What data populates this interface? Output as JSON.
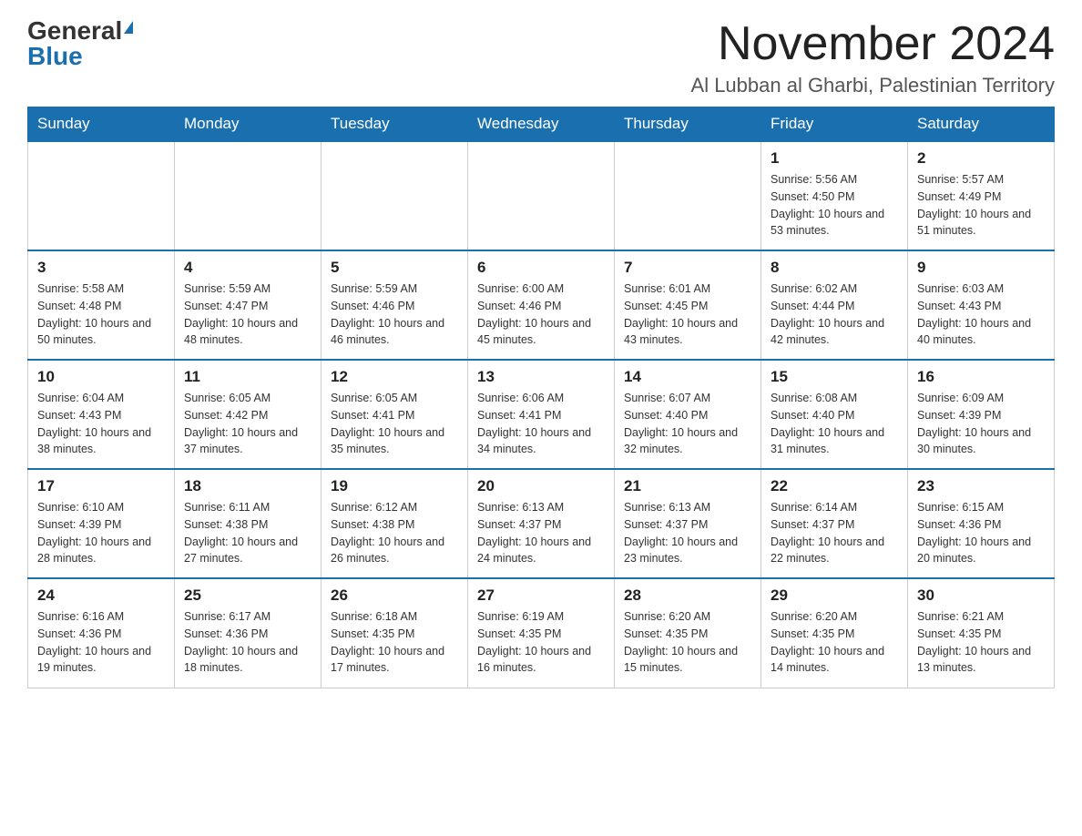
{
  "header": {
    "logo_general": "General",
    "logo_blue": "Blue",
    "month_title": "November 2024",
    "location": "Al Lubban al Gharbi, Palestinian Territory"
  },
  "columns": [
    "Sunday",
    "Monday",
    "Tuesday",
    "Wednesday",
    "Thursday",
    "Friday",
    "Saturday"
  ],
  "weeks": [
    [
      {
        "day": "",
        "sunrise": "",
        "sunset": "",
        "daylight": ""
      },
      {
        "day": "",
        "sunrise": "",
        "sunset": "",
        "daylight": ""
      },
      {
        "day": "",
        "sunrise": "",
        "sunset": "",
        "daylight": ""
      },
      {
        "day": "",
        "sunrise": "",
        "sunset": "",
        "daylight": ""
      },
      {
        "day": "",
        "sunrise": "",
        "sunset": "",
        "daylight": ""
      },
      {
        "day": "1",
        "sunrise": "Sunrise: 5:56 AM",
        "sunset": "Sunset: 4:50 PM",
        "daylight": "Daylight: 10 hours and 53 minutes."
      },
      {
        "day": "2",
        "sunrise": "Sunrise: 5:57 AM",
        "sunset": "Sunset: 4:49 PM",
        "daylight": "Daylight: 10 hours and 51 minutes."
      }
    ],
    [
      {
        "day": "3",
        "sunrise": "Sunrise: 5:58 AM",
        "sunset": "Sunset: 4:48 PM",
        "daylight": "Daylight: 10 hours and 50 minutes."
      },
      {
        "day": "4",
        "sunrise": "Sunrise: 5:59 AM",
        "sunset": "Sunset: 4:47 PM",
        "daylight": "Daylight: 10 hours and 48 minutes."
      },
      {
        "day": "5",
        "sunrise": "Sunrise: 5:59 AM",
        "sunset": "Sunset: 4:46 PM",
        "daylight": "Daylight: 10 hours and 46 minutes."
      },
      {
        "day": "6",
        "sunrise": "Sunrise: 6:00 AM",
        "sunset": "Sunset: 4:46 PM",
        "daylight": "Daylight: 10 hours and 45 minutes."
      },
      {
        "day": "7",
        "sunrise": "Sunrise: 6:01 AM",
        "sunset": "Sunset: 4:45 PM",
        "daylight": "Daylight: 10 hours and 43 minutes."
      },
      {
        "day": "8",
        "sunrise": "Sunrise: 6:02 AM",
        "sunset": "Sunset: 4:44 PM",
        "daylight": "Daylight: 10 hours and 42 minutes."
      },
      {
        "day": "9",
        "sunrise": "Sunrise: 6:03 AM",
        "sunset": "Sunset: 4:43 PM",
        "daylight": "Daylight: 10 hours and 40 minutes."
      }
    ],
    [
      {
        "day": "10",
        "sunrise": "Sunrise: 6:04 AM",
        "sunset": "Sunset: 4:43 PM",
        "daylight": "Daylight: 10 hours and 38 minutes."
      },
      {
        "day": "11",
        "sunrise": "Sunrise: 6:05 AM",
        "sunset": "Sunset: 4:42 PM",
        "daylight": "Daylight: 10 hours and 37 minutes."
      },
      {
        "day": "12",
        "sunrise": "Sunrise: 6:05 AM",
        "sunset": "Sunset: 4:41 PM",
        "daylight": "Daylight: 10 hours and 35 minutes."
      },
      {
        "day": "13",
        "sunrise": "Sunrise: 6:06 AM",
        "sunset": "Sunset: 4:41 PM",
        "daylight": "Daylight: 10 hours and 34 minutes."
      },
      {
        "day": "14",
        "sunrise": "Sunrise: 6:07 AM",
        "sunset": "Sunset: 4:40 PM",
        "daylight": "Daylight: 10 hours and 32 minutes."
      },
      {
        "day": "15",
        "sunrise": "Sunrise: 6:08 AM",
        "sunset": "Sunset: 4:40 PM",
        "daylight": "Daylight: 10 hours and 31 minutes."
      },
      {
        "day": "16",
        "sunrise": "Sunrise: 6:09 AM",
        "sunset": "Sunset: 4:39 PM",
        "daylight": "Daylight: 10 hours and 30 minutes."
      }
    ],
    [
      {
        "day": "17",
        "sunrise": "Sunrise: 6:10 AM",
        "sunset": "Sunset: 4:39 PM",
        "daylight": "Daylight: 10 hours and 28 minutes."
      },
      {
        "day": "18",
        "sunrise": "Sunrise: 6:11 AM",
        "sunset": "Sunset: 4:38 PM",
        "daylight": "Daylight: 10 hours and 27 minutes."
      },
      {
        "day": "19",
        "sunrise": "Sunrise: 6:12 AM",
        "sunset": "Sunset: 4:38 PM",
        "daylight": "Daylight: 10 hours and 26 minutes."
      },
      {
        "day": "20",
        "sunrise": "Sunrise: 6:13 AM",
        "sunset": "Sunset: 4:37 PM",
        "daylight": "Daylight: 10 hours and 24 minutes."
      },
      {
        "day": "21",
        "sunrise": "Sunrise: 6:13 AM",
        "sunset": "Sunset: 4:37 PM",
        "daylight": "Daylight: 10 hours and 23 minutes."
      },
      {
        "day": "22",
        "sunrise": "Sunrise: 6:14 AM",
        "sunset": "Sunset: 4:37 PM",
        "daylight": "Daylight: 10 hours and 22 minutes."
      },
      {
        "day": "23",
        "sunrise": "Sunrise: 6:15 AM",
        "sunset": "Sunset: 4:36 PM",
        "daylight": "Daylight: 10 hours and 20 minutes."
      }
    ],
    [
      {
        "day": "24",
        "sunrise": "Sunrise: 6:16 AM",
        "sunset": "Sunset: 4:36 PM",
        "daylight": "Daylight: 10 hours and 19 minutes."
      },
      {
        "day": "25",
        "sunrise": "Sunrise: 6:17 AM",
        "sunset": "Sunset: 4:36 PM",
        "daylight": "Daylight: 10 hours and 18 minutes."
      },
      {
        "day": "26",
        "sunrise": "Sunrise: 6:18 AM",
        "sunset": "Sunset: 4:35 PM",
        "daylight": "Daylight: 10 hours and 17 minutes."
      },
      {
        "day": "27",
        "sunrise": "Sunrise: 6:19 AM",
        "sunset": "Sunset: 4:35 PM",
        "daylight": "Daylight: 10 hours and 16 minutes."
      },
      {
        "day": "28",
        "sunrise": "Sunrise: 6:20 AM",
        "sunset": "Sunset: 4:35 PM",
        "daylight": "Daylight: 10 hours and 15 minutes."
      },
      {
        "day": "29",
        "sunrise": "Sunrise: 6:20 AM",
        "sunset": "Sunset: 4:35 PM",
        "daylight": "Daylight: 10 hours and 14 minutes."
      },
      {
        "day": "30",
        "sunrise": "Sunrise: 6:21 AM",
        "sunset": "Sunset: 4:35 PM",
        "daylight": "Daylight: 10 hours and 13 minutes."
      }
    ]
  ]
}
